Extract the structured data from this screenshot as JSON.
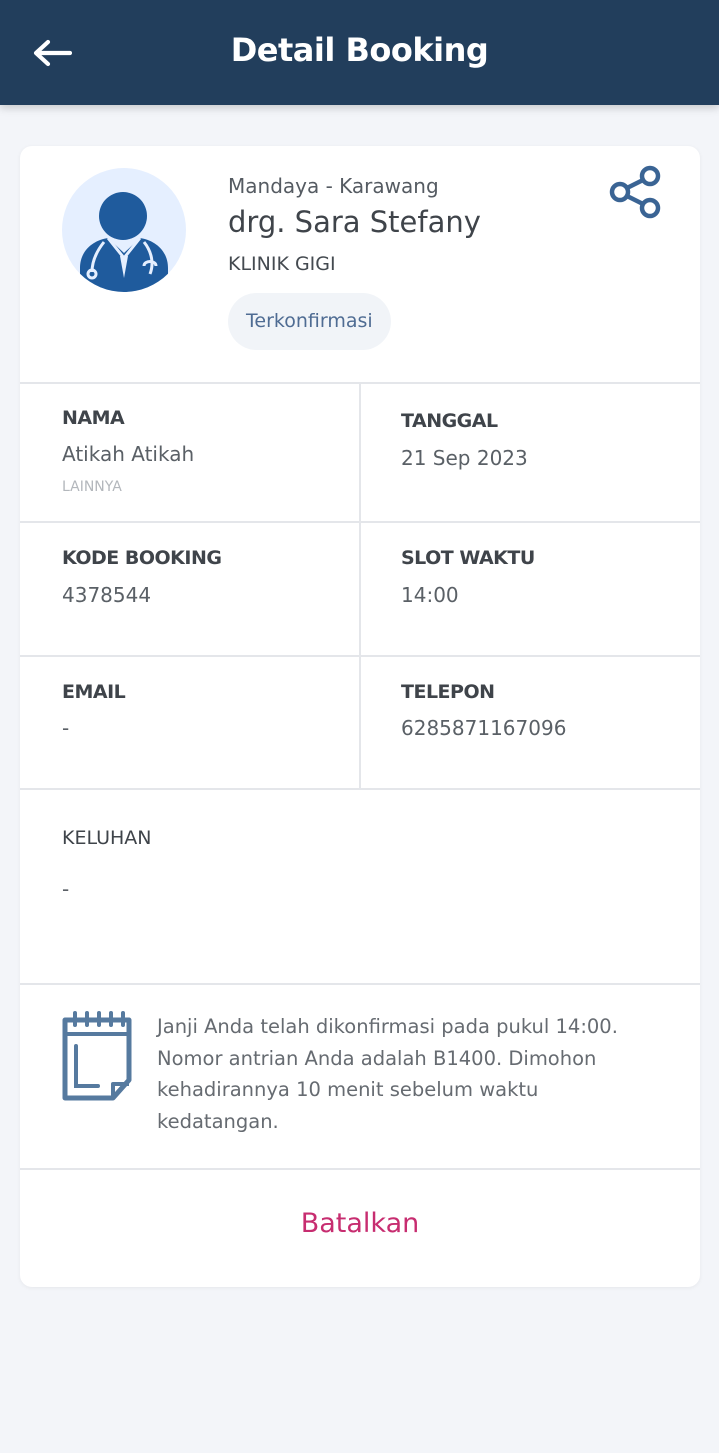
{
  "appbar": {
    "title": "Detail Booking",
    "back_icon": "arrow-left-icon"
  },
  "doctor": {
    "location": "Mandaya - Karawang",
    "name": "drg. Sara Stefany",
    "specialty": "KLINIK GIGI",
    "status": "Terkonfirmasi",
    "avatar_icon": "doctor-avatar-icon",
    "share_icon": "share-icon"
  },
  "details": {
    "nama_label": "NAMA",
    "nama_value": "Atikah Atikah",
    "nama_sub": "LAINNYA",
    "tanggal_label": "TANGGAL",
    "tanggal_value": "21 Sep 2023",
    "kode_label": "KODE BOOKING",
    "kode_value": "4378544",
    "slot_label": "SLOT WAKTU",
    "slot_value": "14:00",
    "email_label": "EMAIL",
    "email_value": "-",
    "telepon_label": "TELEPON",
    "telepon_value": "6285871167096"
  },
  "complaint": {
    "label": "KELUHAN",
    "value": "-"
  },
  "info": {
    "icon": "calendar-icon",
    "text": "Janji Anda telah dikonfirmasi pada pukul 14:00. Nomor antrian Anda adalah B1400. Dimohon kehadirannya 10 menit sebelum waktu kedatangan."
  },
  "actions": {
    "cancel_label": "Batalkan"
  },
  "colors": {
    "appbar": "#223e5c",
    "background": "#f3f5f9",
    "accent_cancel": "#c72d70",
    "badge_text": "#4f6c93",
    "icon_blue": "#3a6494"
  }
}
